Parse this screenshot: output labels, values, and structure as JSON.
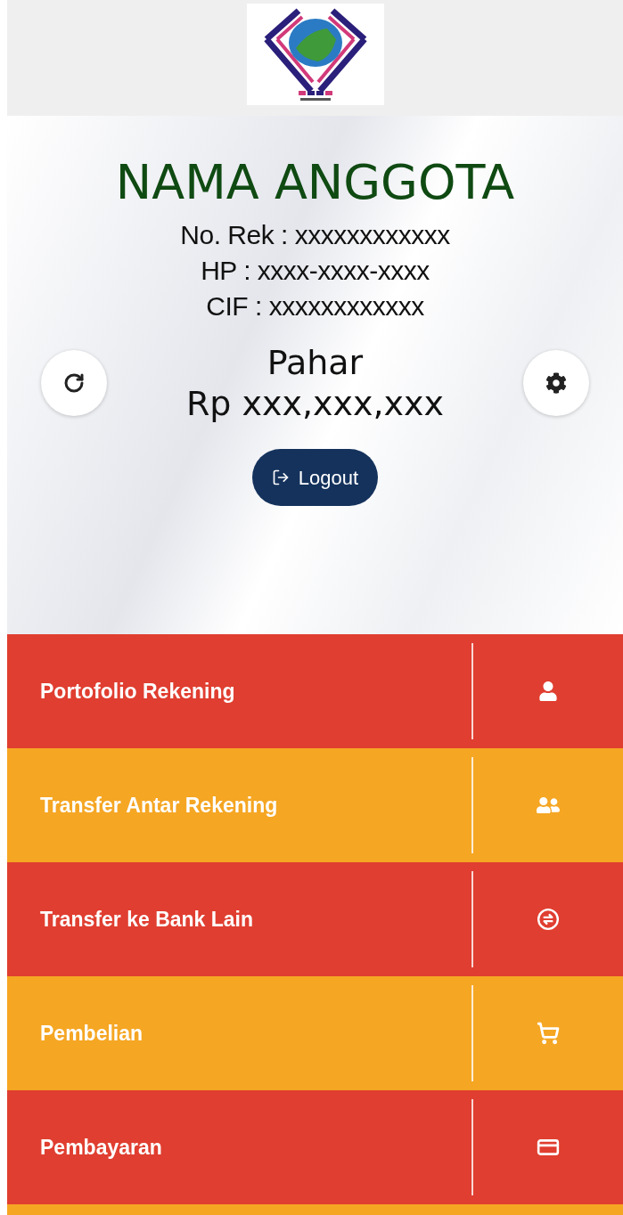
{
  "member": {
    "name": "NAMA ANGGOTA",
    "account": "No. Rek : xxxxxxxxxxxx",
    "phone": "HP : xxxx-xxxx-xxxx",
    "cif": "CIF : xxxxxxxxxxxx"
  },
  "balance": {
    "label": "Pahar",
    "amount": "Rp xxx,xxx,xxx"
  },
  "logout": "Logout",
  "menu": [
    {
      "label": "Portofolio Rekening",
      "color": "#e03e30"
    },
    {
      "label": "Transfer Antar Rekening",
      "color": "#f5a623"
    },
    {
      "label": "Transfer ke Bank Lain",
      "color": "#e03e30"
    },
    {
      "label": "Pembelian",
      "color": "#f5a623"
    },
    {
      "label": "Pembayaran",
      "color": "#e03e30"
    }
  ]
}
